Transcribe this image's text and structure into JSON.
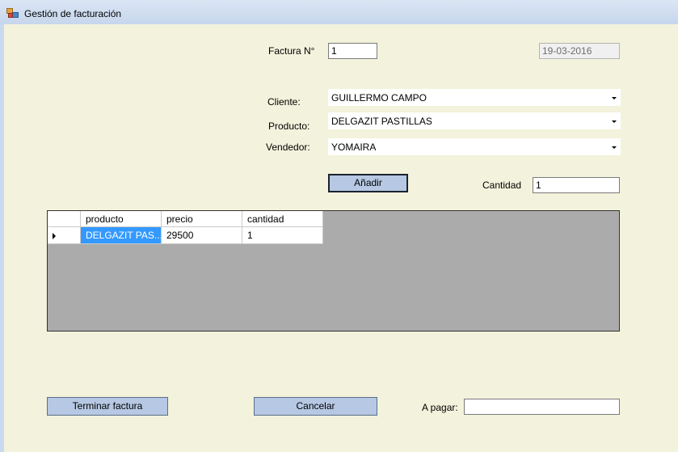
{
  "window": {
    "title": "Gestión de facturación",
    "icon": "app-form-icon"
  },
  "invoice": {
    "number_label": "Factura N°",
    "number_value": "1",
    "date_value": "19-03-2016"
  },
  "fields": {
    "cliente": {
      "label": "Cliente:",
      "value": "GUILLERMO CAMPO"
    },
    "producto": {
      "label": "Producto:",
      "value": "DELGAZIT PASTILLAS"
    },
    "vendedor": {
      "label": "Vendedor:",
      "value": "YOMAIRA"
    }
  },
  "add": {
    "button_label": "Añadir",
    "quantity_label": "Cantidad",
    "quantity_value": "1"
  },
  "grid": {
    "columns": [
      "producto",
      "precio",
      "cantidad"
    ],
    "rows": [
      {
        "producto": "DELGAZIT PAS...",
        "precio": "29500",
        "cantidad": "1"
      }
    ]
  },
  "footer": {
    "finish_label": "Terminar factura",
    "cancel_label": "Cancelar",
    "total_label": "A pagar:",
    "total_value": ""
  },
  "colors": {
    "client_bg": "#f3f2dc",
    "button_bg": "#b6c8e3",
    "selection": "#3399ff",
    "grid_bg": "#ababab"
  }
}
